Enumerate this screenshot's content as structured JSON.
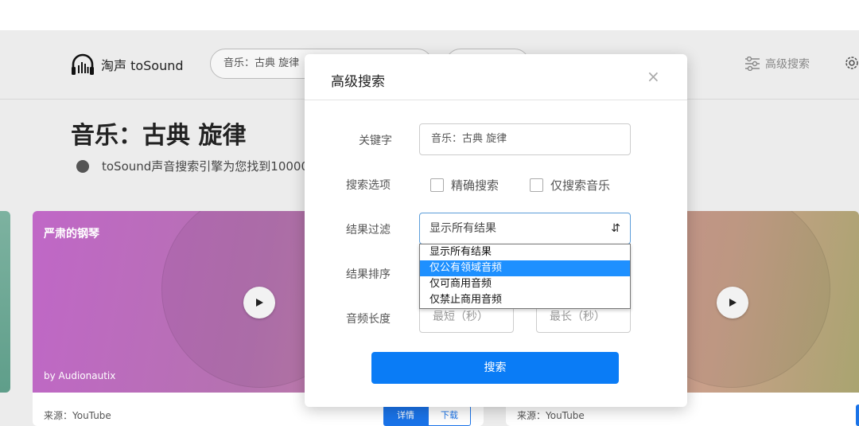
{
  "header": {
    "logo_text": "淘声 toSound",
    "search_value": "音乐：古典 旋律",
    "advanced_label": "高级搜索"
  },
  "page": {
    "title": "音乐：古典 旋律",
    "result_text": "toSound声音搜索引擎为您找到10000"
  },
  "cards": [
    {
      "title": "严肃的钢琴",
      "author": "by Audionautix",
      "source": "来源：YouTube",
      "detail_label": "详情",
      "download_label": "下载"
    },
    {
      "source": "来源：YouTube"
    }
  ],
  "modal": {
    "title": "高级搜索",
    "close": "×",
    "keyword_label": "关键字",
    "keyword_value": "音乐：古典 旋律",
    "options_label": "搜索选项",
    "option_exact": "精确搜索",
    "option_music_only": "仅搜索音乐",
    "filter_label": "结果过滤",
    "filter_value": "显示所有结果",
    "sort_label": "结果排序",
    "length_label": "音频长度",
    "min_placeholder": "最短（秒）",
    "max_placeholder": "最长（秒）",
    "search_button": "搜索"
  },
  "dropdown": {
    "options": [
      "显示所有结果",
      "仅公有领域音频",
      "仅可商用音频",
      "仅禁止商用音频"
    ],
    "highlighted_index": 1
  },
  "colors": {
    "accent": "#0a7cf6",
    "highlight": "#1e90ff"
  }
}
